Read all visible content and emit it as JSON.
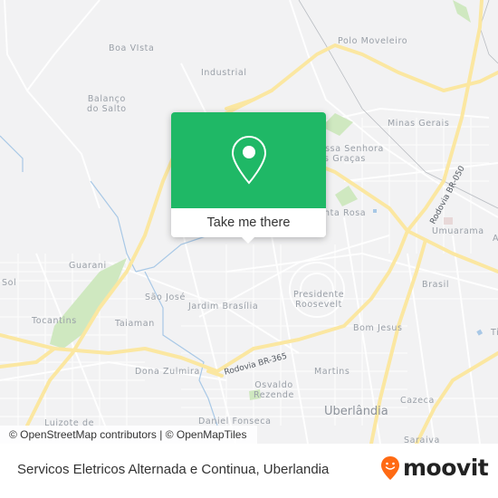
{
  "map": {
    "neighborhoods": [
      {
        "id": "boa-vista",
        "text": "Boa VIsta"
      },
      {
        "id": "industrial",
        "text": "Industrial"
      },
      {
        "id": "balanco-do-salto",
        "text": "Balanço\ndo Salto"
      },
      {
        "id": "polo-moveleiro",
        "text": "Polo Moveleiro"
      },
      {
        "id": "minas-gerais",
        "text": "Minas Gerais"
      },
      {
        "id": "nossa-senhora",
        "text": "Nossa Senhora\ndas Graças"
      },
      {
        "id": "santa-rosa",
        "text": "Santa Rosa"
      },
      {
        "id": "umuarama",
        "text": "Umuarama"
      },
      {
        "id": "guarani",
        "text": "Guarani"
      },
      {
        "id": "sol",
        "text": "Sol"
      },
      {
        "id": "sao-jose",
        "text": "São José"
      },
      {
        "id": "jardim-brasilia",
        "text": "Jardim Brasília"
      },
      {
        "id": "presidente-roosevelt",
        "text": "Presidente\nRoosevelt"
      },
      {
        "id": "brasil",
        "text": "Brasil"
      },
      {
        "id": "tocantins",
        "text": "Tocantins"
      },
      {
        "id": "taiaman",
        "text": "Taiaman"
      },
      {
        "id": "bom-jesus",
        "text": "Bom Jesus"
      },
      {
        "id": "dona-zulmira",
        "text": "Dona Zulmira"
      },
      {
        "id": "martins",
        "text": "Martins"
      },
      {
        "id": "osvaldo-rezende",
        "text": "Osvaldo\nRezende"
      },
      {
        "id": "cazeca",
        "text": "Cazeca"
      },
      {
        "id": "luizote",
        "text": "Luizote de"
      },
      {
        "id": "daniel-fonseca",
        "text": "Daniel Fonseca"
      },
      {
        "id": "saraiva",
        "text": "Saraiva"
      },
      {
        "id": "ti",
        "text": "Ti"
      },
      {
        "id": "a",
        "text": "A"
      }
    ],
    "city_label": "Uberlândia",
    "roads": [
      {
        "id": "br-365",
        "text": "Rodovia BR-365"
      },
      {
        "id": "br-050",
        "text": "Rodovia BR-050"
      }
    ],
    "colors": {
      "background": "#f2f2f3",
      "road_major": "#fbe7a1",
      "road_minor": "#ffffff",
      "park": "#cfe8c0",
      "water": "#a8c8e6"
    }
  },
  "popup": {
    "icon": "map-pin-icon",
    "button_label": "Take me there",
    "accent_color": "#1fb866"
  },
  "attribution": "© OpenStreetMap contributors | © OpenMapTiles",
  "footer": {
    "place_name": "Servicos Eletricos Alternada e Continua, Uberlandia",
    "brand": "moovit",
    "brand_color": "#ff6a13"
  }
}
